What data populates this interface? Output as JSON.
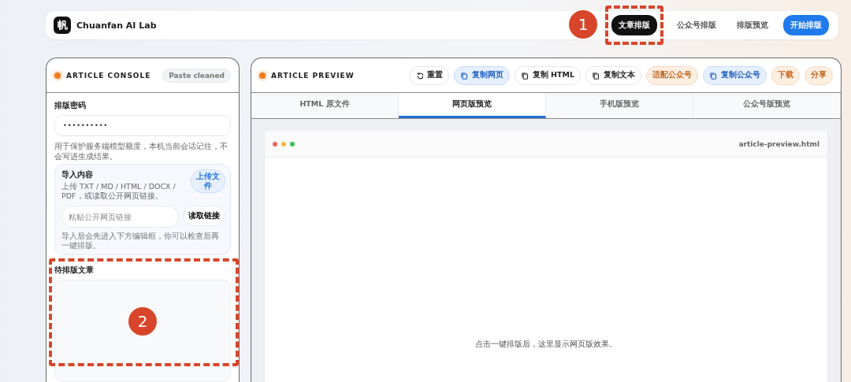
{
  "brand": {
    "logo": "帆",
    "name": "Chuanfan AI Lab"
  },
  "nav": [
    {
      "label": "文章排版",
      "selected": true
    },
    {
      "label": "公众号排版",
      "selected": false
    },
    {
      "label": "排版预览",
      "selected": false
    }
  ],
  "primary_button": "开始排版",
  "console": {
    "title": "ARTICLE CONSOLE",
    "badge": "Paste cleaned",
    "password_label": "排版密码",
    "password_value": "••••••••••",
    "password_hint": "用于保护服务端模型额度，本机当前会话记住，不会写进生成结果。",
    "import": {
      "title": "导入内容",
      "description": "上传 TXT / MD / HTML / DOCX / PDF，或读取公开网页链接。",
      "upload_button": "上传文件",
      "url_placeholder": "粘贴公开网页链接",
      "fetch_button": "读取链接",
      "note": "导入后会先进入下方编辑框，你可以检查后再一键排版。"
    },
    "editor_label": "待排版文章"
  },
  "preview": {
    "title": "ARTICLE PREVIEW",
    "actions": [
      {
        "label": "重置",
        "kind": "reset"
      },
      {
        "label": "复制网页",
        "kind": "copyaccent"
      },
      {
        "label": "复制 HTML",
        "kind": "copy"
      },
      {
        "label": "复制文本",
        "kind": "copy"
      },
      {
        "label": "适配公众号",
        "kind": "accent"
      },
      {
        "label": "复制公众号",
        "kind": "copyaccent"
      },
      {
        "label": "下载",
        "kind": "accent"
      },
      {
        "label": "分享",
        "kind": "accent"
      }
    ],
    "tabs": [
      {
        "label": "HTML 原文件",
        "selected": false
      },
      {
        "label": "网页版预览",
        "selected": true
      },
      {
        "label": "手机版预览",
        "selected": false
      },
      {
        "label": "公众号版预览",
        "selected": false
      }
    ],
    "file_name": "article-preview.html",
    "empty_message": "点击一键排版后，这里显示网页版效果。"
  },
  "annotations": [
    {
      "number": "1"
    },
    {
      "number": "2"
    }
  ]
}
